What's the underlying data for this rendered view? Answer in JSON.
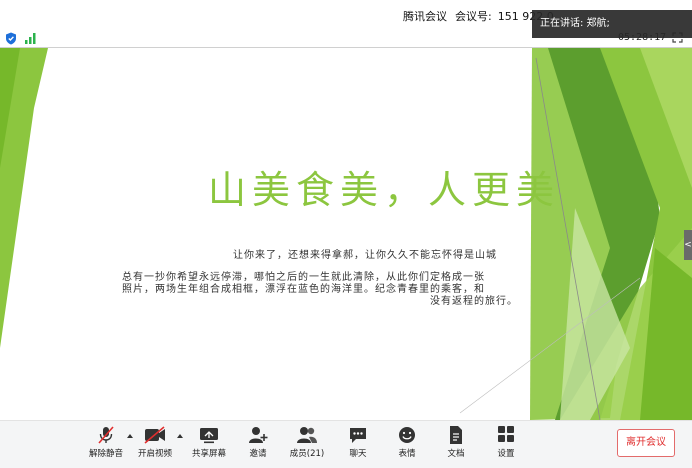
{
  "window": {
    "app_name": "腾讯会议",
    "meeting_id_label": "会议号:",
    "meeting_id": "151 922 0"
  },
  "status": {
    "timer": "05:28:17",
    "speaking_notice": "正在讲话: 郑航;"
  },
  "slide": {
    "title": "山美食美，人更美",
    "lines": [
      "让你来了，还想来得拿郝，让你久久不能忘怀得是山城",
      "总有一抄你希望永远停滞，哪怕之后的一生就此清除，从此你们定格成一张",
      "照片，两场生年组合成相框，漂浮在蓝色的海洋里。纪念青春里的乘客，和",
      "没有返程的旅行。"
    ],
    "side_tab": "<"
  },
  "toolbar": {
    "items": [
      {
        "label": "解除静音",
        "icon": "mic-muted-icon"
      },
      {
        "label": "开启视频",
        "icon": "video-off-icon"
      },
      {
        "label": "共享屏幕",
        "icon": "share-screen-icon"
      },
      {
        "label": "邀请",
        "icon": "invite-icon"
      },
      {
        "label": "成员(21)",
        "icon": "members-icon"
      },
      {
        "label": "聊天",
        "icon": "chat-icon"
      },
      {
        "label": "表情",
        "icon": "emoji-icon"
      },
      {
        "label": "文档",
        "icon": "document-icon"
      },
      {
        "label": "设置",
        "icon": "settings-icon"
      }
    ],
    "leave_label": "离开会议"
  },
  "colors": {
    "accent_green": "#8cc63f",
    "leave_red": "#e02e2e"
  }
}
